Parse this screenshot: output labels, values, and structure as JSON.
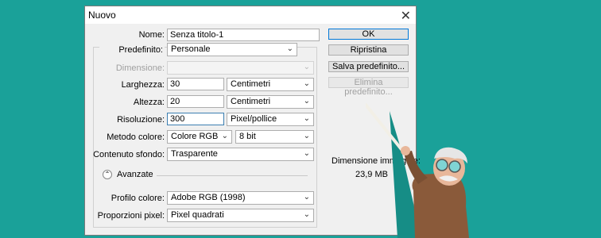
{
  "dialog": {
    "title": "Nuovo",
    "close_icon": "close-icon"
  },
  "form": {
    "nome": {
      "label": "Nome:",
      "value": "Senza titolo-1"
    },
    "predefinito": {
      "label": "Predefinito:",
      "value": "Personale"
    },
    "dimensione": {
      "label": "Dimensione:",
      "value": ""
    },
    "larghezza": {
      "label": "Larghezza:",
      "value": "30",
      "unit": "Centimetri"
    },
    "altezza": {
      "label": "Altezza:",
      "value": "20",
      "unit": "Centimetri"
    },
    "risoluzione": {
      "label": "Risoluzione:",
      "value": "300",
      "unit": "Pixel/pollice"
    },
    "metodo_colore": {
      "label": "Metodo colore:",
      "value": "Colore RGB",
      "depth": "8 bit"
    },
    "contenuto_sfondo": {
      "label": "Contenuto sfondo:",
      "value": "Trasparente"
    },
    "avanzate": {
      "label": "Avanzate"
    },
    "profilo_colore": {
      "label": "Profilo colore:",
      "value": "Adobe RGB (1998)"
    },
    "proporzioni_pixel": {
      "label": "Proporzioni pixel:",
      "value": "Pixel quadrati"
    }
  },
  "buttons": {
    "ok": "OK",
    "ripristina": "Ripristina",
    "salva_predefinito": "Salva predefinito...",
    "elimina_predefinito": "Elimina predefinito..."
  },
  "info": {
    "size_label": "Dimensione immagine:",
    "size_value": "23,9 MB"
  },
  "colors": {
    "background": "#1aa199",
    "accent": "#0078d7"
  }
}
